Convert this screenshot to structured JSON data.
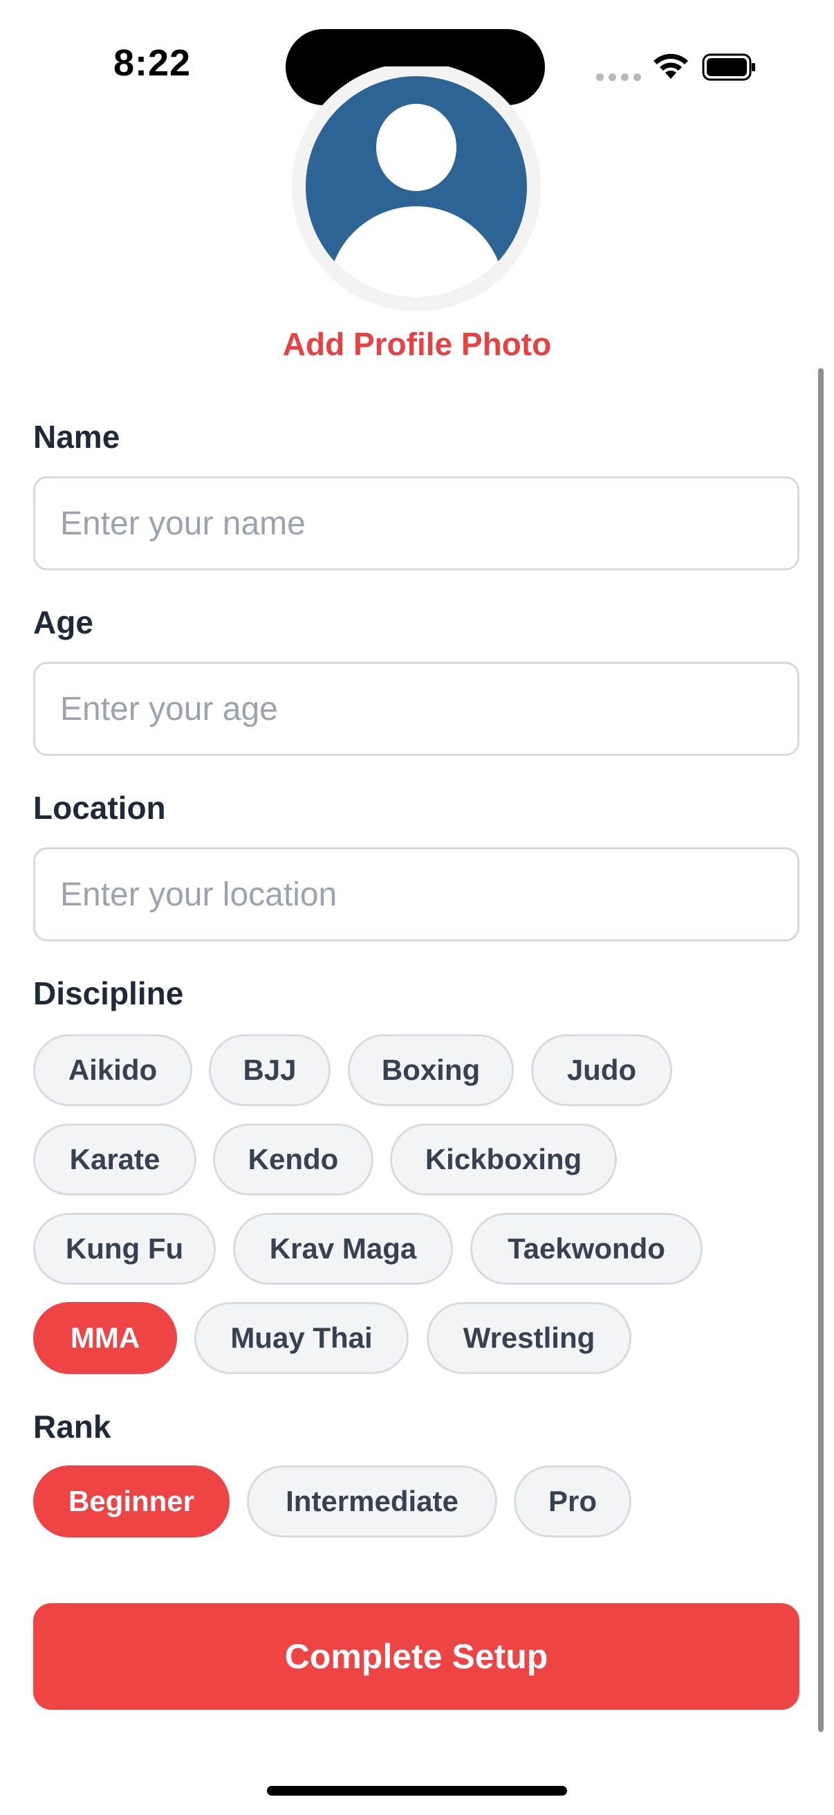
{
  "status_bar": {
    "time": "8:22"
  },
  "profile": {
    "add_photo_label": "Add Profile Photo",
    "avatar_color": "#2c6496"
  },
  "form": {
    "name": {
      "label": "Name",
      "placeholder": "Enter your name",
      "value": ""
    },
    "age": {
      "label": "Age",
      "placeholder": "Enter your age",
      "value": ""
    },
    "location": {
      "label": "Location",
      "placeholder": "Enter your location",
      "value": ""
    }
  },
  "discipline": {
    "label": "Discipline",
    "options": [
      "Aikido",
      "BJJ",
      "Boxing",
      "Judo",
      "Karate",
      "Kendo",
      "Kickboxing",
      "Kung Fu",
      "Krav Maga",
      "Taekwondo",
      "MMA",
      "Muay Thai",
      "Wrestling"
    ],
    "selected": "MMA"
  },
  "rank": {
    "label": "Rank",
    "options": [
      "Beginner",
      "Intermediate",
      "Pro"
    ],
    "selected": "Beginner"
  },
  "actions": {
    "complete_label": "Complete Setup"
  },
  "colors": {
    "accent": "#ef4444",
    "chip_background": "#f3f4f6",
    "chip_border": "#d8dbe0",
    "placeholder": "#9ca3af",
    "text": "#1f2937"
  },
  "icons": {
    "wifi": "wifi-icon",
    "battery": "battery-icon",
    "signal": "cellular-signal-icon",
    "avatar": "person-icon"
  }
}
